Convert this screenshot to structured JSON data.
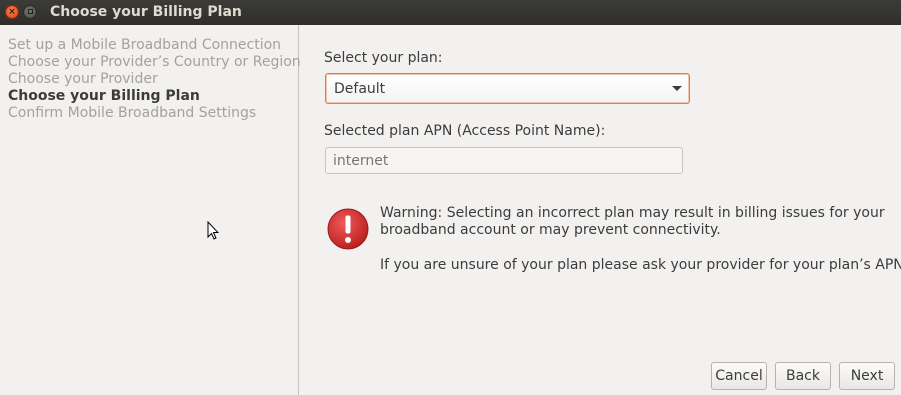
{
  "window": {
    "title": "Choose your Billing Plan",
    "close_glyph": "×",
    "close_icon": "close-icon",
    "minimize_icon": "minimize-icon"
  },
  "sidebar": {
    "steps": [
      {
        "label": "Set up a Mobile Broadband Connection",
        "current": false
      },
      {
        "label": "Choose your Provider’s Country or Region",
        "current": false
      },
      {
        "label": "Choose your Provider",
        "current": false
      },
      {
        "label": "Choose your Billing Plan",
        "current": true
      },
      {
        "label": "Confirm Mobile Broadband Settings",
        "current": false
      }
    ]
  },
  "main": {
    "plan_label": "Select your plan:",
    "plan_value": "Default",
    "apn_label": "Selected plan APN (Access Point Name):",
    "apn_placeholder": "internet",
    "warning": {
      "icon": "warning-icon",
      "line1": "Warning: Selecting an incorrect plan may result in billing issues for your",
      "line2": "broadband account or may prevent connectivity.",
      "line3": "If you are unsure of your plan please ask your provider for your plan’s APN."
    }
  },
  "buttons": {
    "cancel": "Cancel",
    "back": "Back",
    "next": "Next"
  },
  "colors": {
    "titlebar": "#3c3b37",
    "focus_border": "#e07a55",
    "warning_red": "#d22d2d"
  }
}
